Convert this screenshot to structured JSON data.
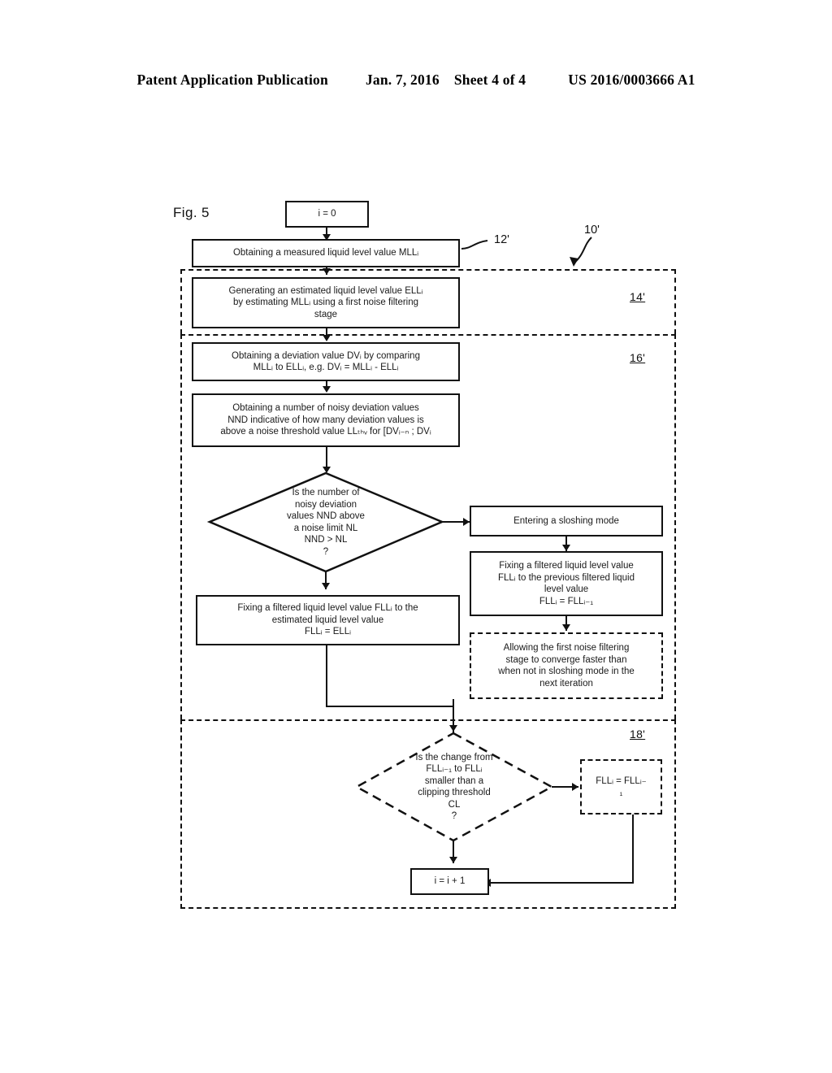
{
  "header": {
    "publication": "Patent Application Publication",
    "date": "Jan. 7, 2016",
    "sheet": "Sheet 4 of 4",
    "patent_number": "US 2016/0003666 A1"
  },
  "figure": {
    "label": "Fig. 5",
    "overall_ref": "10'",
    "region_refs": {
      "first_stage": "14'",
      "second_stage": "16'",
      "third_stage": "18'"
    },
    "lead_refs": {
      "obtain_measured": "12'"
    },
    "nodes": {
      "init": "i = 0",
      "obtain_measured": "Obtaining a measured liquid level value MLLᵢ",
      "generate_estimate_l1": "Generating an estimated liquid level value ELLᵢ",
      "generate_estimate_l2": "by estimating MLLᵢ using a first noise filtering",
      "generate_estimate_l3": "stage",
      "deviation_l1": "Obtaining a deviation value DVᵢ by comparing",
      "deviation_l2": "MLLᵢ to ELLᵢ, e.g. DVᵢ = MLLᵢ - ELLᵢ",
      "nnd_l1": "Obtaining a number of noisy deviation values",
      "nnd_l2": "NND indicative of how many deviation values is",
      "nnd_l3": "above a noise threshold value LLₜₕᵥ for [DVᵢ₋ₙ ; DVᵢ",
      "decision_noise_l1": "Is the number of",
      "decision_noise_l2": "noisy deviation",
      "decision_noise_l3": "values NND above",
      "decision_noise_l4": "a noise limit NL",
      "decision_noise_l5": "NND > NL",
      "decision_noise_l6": "?",
      "sloshing_mode": "Entering a sloshing mode",
      "fix_prev_l1": "Fixing a filtered liquid level value",
      "fix_prev_l2": "FLLᵢ to the previous filtered liquid",
      "fix_prev_l3": "level value",
      "fix_prev_l4": "FLLᵢ = FLLᵢ₋₁",
      "converge_l1": "Allowing the first noise filtering",
      "converge_l2": "stage to converge faster  than",
      "converge_l3": "when not in sloshing mode in the",
      "converge_l4": "next iteration",
      "fix_est_l1": "Fixing a filtered liquid level value FLLᵢ to the",
      "fix_est_l2": "estimated liquid level value",
      "fix_est_l3": "FLLᵢ = ELLᵢ",
      "decision_clip_l1": "Is the change from",
      "decision_clip_l2": "FLLᵢ₋₁ to FLLᵢ",
      "decision_clip_l3": "smaller than a",
      "decision_clip_l4": "clipping threshold",
      "decision_clip_l5": "CL",
      "decision_clip_l6": "?",
      "clip_assign_l1": "FLLᵢ = FLLᵢ₋",
      "clip_assign_l2": "₁",
      "increment": "i = i + 1"
    }
  }
}
